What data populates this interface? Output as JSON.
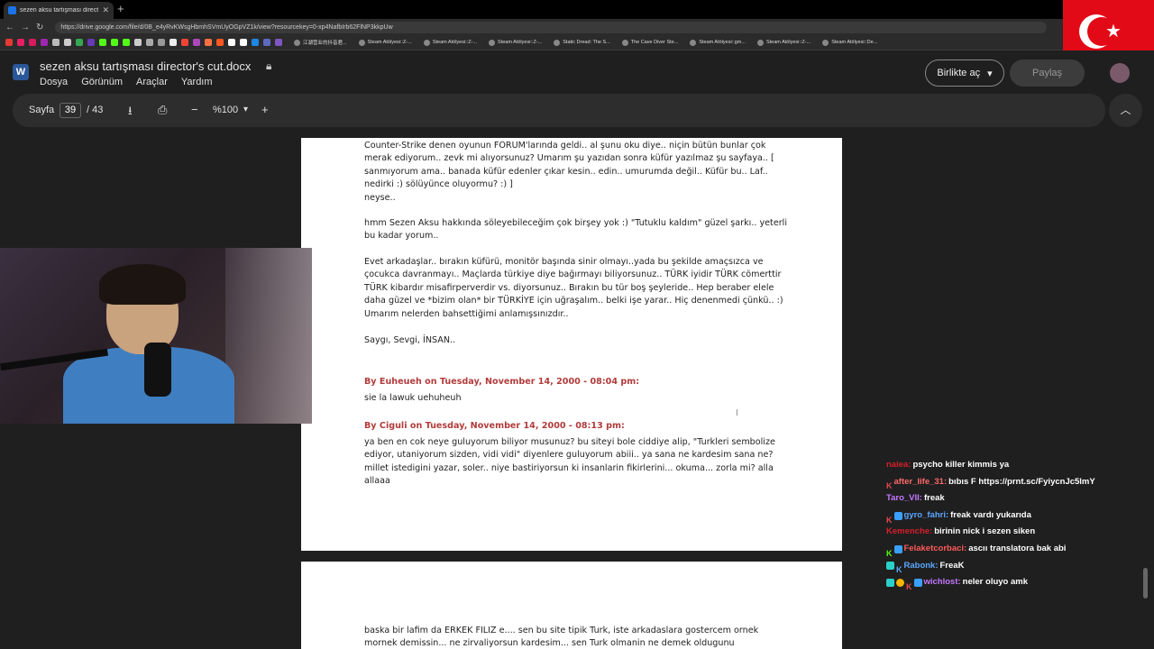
{
  "browser": {
    "tab_title": "sezen aksu tartışması director's cut",
    "url": "https://drive.google.com/file/d/0B_e4yRvKWsgHbmhSVmUyOGpVZ1k/view?resourcekey=0-xp4NafbIrb62FlNP3kkpUw",
    "bookmarks": [
      "江湖营业的抖音君...",
      "Steam Atölyesi::Z-...",
      "Steam Atölyesi::Z-...",
      "Steam Atölyesi::Z-...",
      "Static Dread: The S...",
      "The Cave Diver Ste...",
      "Steam Atölyesi::gm...",
      "Steam Atölyesi::Z-...",
      "Steam Atölyesi::De..."
    ]
  },
  "doc": {
    "title": "sezen aksu tartışması director's cut.docx",
    "menus": [
      "Dosya",
      "Görünüm",
      "Araçlar",
      "Yardım"
    ],
    "open_with_label": "Birlikte aç",
    "share_label": "Paylaş"
  },
  "toolbar": {
    "page_label": "Sayfa",
    "current_page": "39",
    "total_pages": "/ 43",
    "zoom": "%100"
  },
  "page1": {
    "para1": "Counter-Strike denen oyunun FORUM'larında geldi.. al şunu oku diye.. niçin bütün bunlar çok merak ediyorum.. zevk mi alıyorsunuz? Umarım şu yazıdan sonra küfür yazılmaz şu sayfaya.. [ sanmıyorum ama.. banada küfür edenler çıkar kesin.. edin.. umurumda değil.. Küfür bu.. Laf.. nedirki :) sölüyünce oluyormu? :) ]",
    "para1b": "neyse..",
    "para2": "hmm Sezen Aksu hakkında söleyebileceğim çok birşey yok :) \"Tutuklu kaldım\" güzel şarkı.. yeterli bu kadar yorum..",
    "para3": "Evet arkadaşlar.. bırakın küfürü, monitör başında sinir olmayı..yada bu şekilde amaçsızca ve çocukca davranmayı.. Maçlarda türkiye diye bağırmayı biliyorsunuz.. TÜRK iyidir TÜRK cömerttir TÜRK kibardır misafirperverdir vs. diyorsunuz.. Bırakın bu tür boş şeyleride.. Hep beraber elele daha güzel ve *bizim olan* bir TÜRKİYE için uğraşalım.. belki işe yarar.. Hiç denenmedi çünkü.. :) Umarım nelerden bahsettiğimi anlamışsınızdır..",
    "para4": "Saygı, Sevgi, İNSAN..",
    "head1": "By Euheueh on Tuesday, November 14, 2000 - 08:04 pm:",
    "body1": "sie la lawuk uehuheuh",
    "head2": "By Ciguli on Tuesday, November 14, 2000 - 08:13 pm:",
    "body2": "ya ben en cok neye guluyorum biliyor musunuz? bu siteyi bole ciddiye alip, \"Turkleri sembolize ediyor, utaniyorum sizden, vidi vidi\" diyenlere guluyorum abiii.. ya sana ne kardesim sana ne? millet istedigini yazar, soler.. niye bastiriyorsun ki insanlarin fikirlerini... okuma... zorla mi? alla allaaa"
  },
  "page2": {
    "para1": "baska bir lafim da ERKEK FILIZ e.... sen bu site tipik Turk, iste arkadaslara gostercem ornek mornek demissin... ne zirvaliyorsun kardesim... sen Turk olmanin ne demek oldugunu"
  },
  "chat": [
    {
      "user": "naiea:",
      "text": "psycho killer kimmis ya",
      "color": "#d6202c"
    },
    {
      "user": "after_life_31:",
      "text": "bıbıs F https://prnt.sc/FyiycnJc5lmY",
      "color": "#ff6a6a"
    },
    {
      "user": "Taro_VII:",
      "text": "freak",
      "color": "#c678ff"
    },
    {
      "user": "gyro_fahri:",
      "text": "freak vardı yukarıda",
      "color": "#5aa7ff"
    },
    {
      "user": "Kemenche:",
      "text": "birinin nick i sezen siken",
      "color": "#d6202c"
    },
    {
      "user": "Felaketcorbaci:",
      "text": "ascıı translatora bak abi",
      "color": "#ff5a5a"
    },
    {
      "user": "Rabonk:",
      "text": "FreaK",
      "color": "#5aa7ff"
    },
    {
      "user": "wichlost:",
      "text": "neler oluyo amk",
      "color": "#c678ff"
    }
  ],
  "colors": {
    "app_bg": "#1f1f1f",
    "page_bg": "#ffffff",
    "post_header": "#b23b3b",
    "word_blue": "#2b579a",
    "flag_red": "#e30a17"
  },
  "icons": [
    "google-drive-icon",
    "word-doc-icon",
    "lock-icon",
    "download-icon",
    "print-icon",
    "zoom-out-icon",
    "zoom-in-icon",
    "chevron-up-icon",
    "turkish-flag"
  ]
}
